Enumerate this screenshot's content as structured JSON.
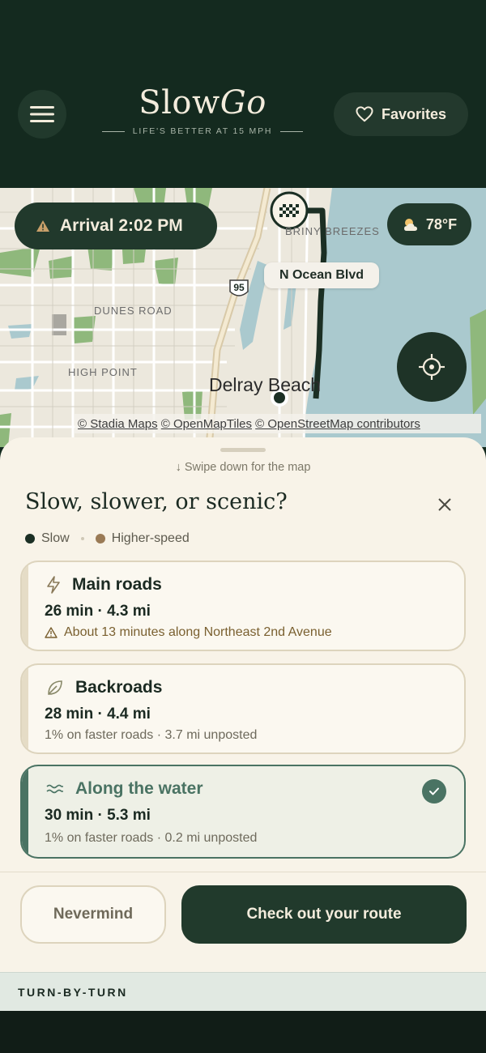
{
  "header": {
    "brand_slow": "Slow",
    "brand_go": "Go",
    "tagline": "LIFE'S BETTER AT 15 MPH",
    "favorites_label": "Favorites"
  },
  "map": {
    "arrival": "Arrival 2:02 PM",
    "weather": "78°F",
    "street_pill": "N Ocean Blvd",
    "highway_shield": "95",
    "labels": {
      "briny": "BRINY BREEZES",
      "dunes": "DUNES ROAD",
      "high_point": "HIGH POINT",
      "city": "Delray Beach"
    },
    "attribution": {
      "stadia": "© Stadia Maps",
      "omt": "© OpenMapTiles",
      "osm": "© OpenStreetMap contributors"
    },
    "colors": {
      "water": "#aac9ce",
      "park": "#8fb87c",
      "route": "#1b2f24",
      "road": "#ffffff"
    }
  },
  "sheet": {
    "swipe_hint": "↓  Swipe down for the map",
    "title": "Slow, slower, or scenic?",
    "legend": {
      "slow": "Slow",
      "higher": "Higher-speed"
    },
    "routes": [
      {
        "name": "Main roads",
        "stats": "26 min · 4.3 mi",
        "note": "About 13 minutes along Northeast 2nd Avenue",
        "icon": "lightning-icon",
        "selected": false
      },
      {
        "name": "Backroads",
        "stats": "28 min · 4.4 mi",
        "note": "1% on faster roads · 3.7 mi unposted",
        "icon": "leaf-icon",
        "selected": false
      },
      {
        "name": "Along the water",
        "stats": "30 min · 5.3 mi",
        "note": "1% on faster roads · 0.2 mi unposted",
        "icon": "waves-icon",
        "selected": true
      }
    ],
    "nevermind": "Nevermind",
    "check_route": "Check out your route",
    "turn_by_turn": "TURN-BY-TURN"
  }
}
